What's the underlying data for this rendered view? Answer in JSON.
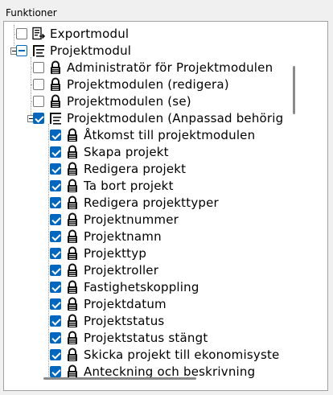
{
  "panel": {
    "title": "Funktioner"
  },
  "tree": {
    "items": [
      {
        "label": "Exportmodul",
        "icon": "export-module-icon",
        "state": "unchecked",
        "level": 0
      },
      {
        "label": "Projektmodul",
        "icon": "list-module-icon",
        "state": "partial",
        "level": 0,
        "expanded": true
      },
      {
        "label": "Administratör för Projektmodulen",
        "icon": "lock-icon",
        "state": "unchecked",
        "level": 1
      },
      {
        "label": "Projektmodulen (redigera)",
        "icon": "lock-icon",
        "state": "unchecked",
        "level": 1
      },
      {
        "label": "Projektmodulen (se)",
        "icon": "lock-icon",
        "state": "unchecked",
        "level": 1
      },
      {
        "label": "Projektmodulen (Anpassad behörig",
        "icon": "list-module-icon",
        "state": "checked",
        "level": 1,
        "expanded": true
      },
      {
        "label": "Åtkomst till projektmodulen",
        "icon": "lock-icon",
        "state": "checked",
        "level": 2
      },
      {
        "label": "Skapa projekt",
        "icon": "lock-icon",
        "state": "checked",
        "level": 2
      },
      {
        "label": "Redigera projekt",
        "icon": "lock-icon",
        "state": "checked",
        "level": 2
      },
      {
        "label": "Ta bort projekt",
        "icon": "lock-icon",
        "state": "checked",
        "level": 2
      },
      {
        "label": "Redigera projekttyper",
        "icon": "lock-icon",
        "state": "checked",
        "level": 2
      },
      {
        "label": "Projektnummer",
        "icon": "lock-icon",
        "state": "checked",
        "level": 2
      },
      {
        "label": "Projektnamn",
        "icon": "lock-icon",
        "state": "checked",
        "level": 2
      },
      {
        "label": "Projekttyp",
        "icon": "lock-icon",
        "state": "checked",
        "level": 2
      },
      {
        "label": "Projektroller",
        "icon": "lock-icon",
        "state": "checked",
        "level": 2
      },
      {
        "label": "Fastighetskoppling",
        "icon": "lock-icon",
        "state": "checked",
        "level": 2
      },
      {
        "label": "Projektdatum",
        "icon": "lock-icon",
        "state": "checked",
        "level": 2
      },
      {
        "label": "Projektstatus",
        "icon": "lock-icon",
        "state": "checked",
        "level": 2
      },
      {
        "label": "Projektstatus stängt",
        "icon": "lock-icon",
        "state": "checked",
        "level": 2
      },
      {
        "label": "Skicka projekt till ekonomisyste",
        "icon": "lock-icon",
        "state": "checked",
        "level": 2
      },
      {
        "label": "Anteckning och beskrivning",
        "icon": "lock-icon",
        "state": "checked",
        "level": 2
      }
    ]
  },
  "colors": {
    "accent": "#0067c0",
    "border": "#a0a0a0"
  }
}
